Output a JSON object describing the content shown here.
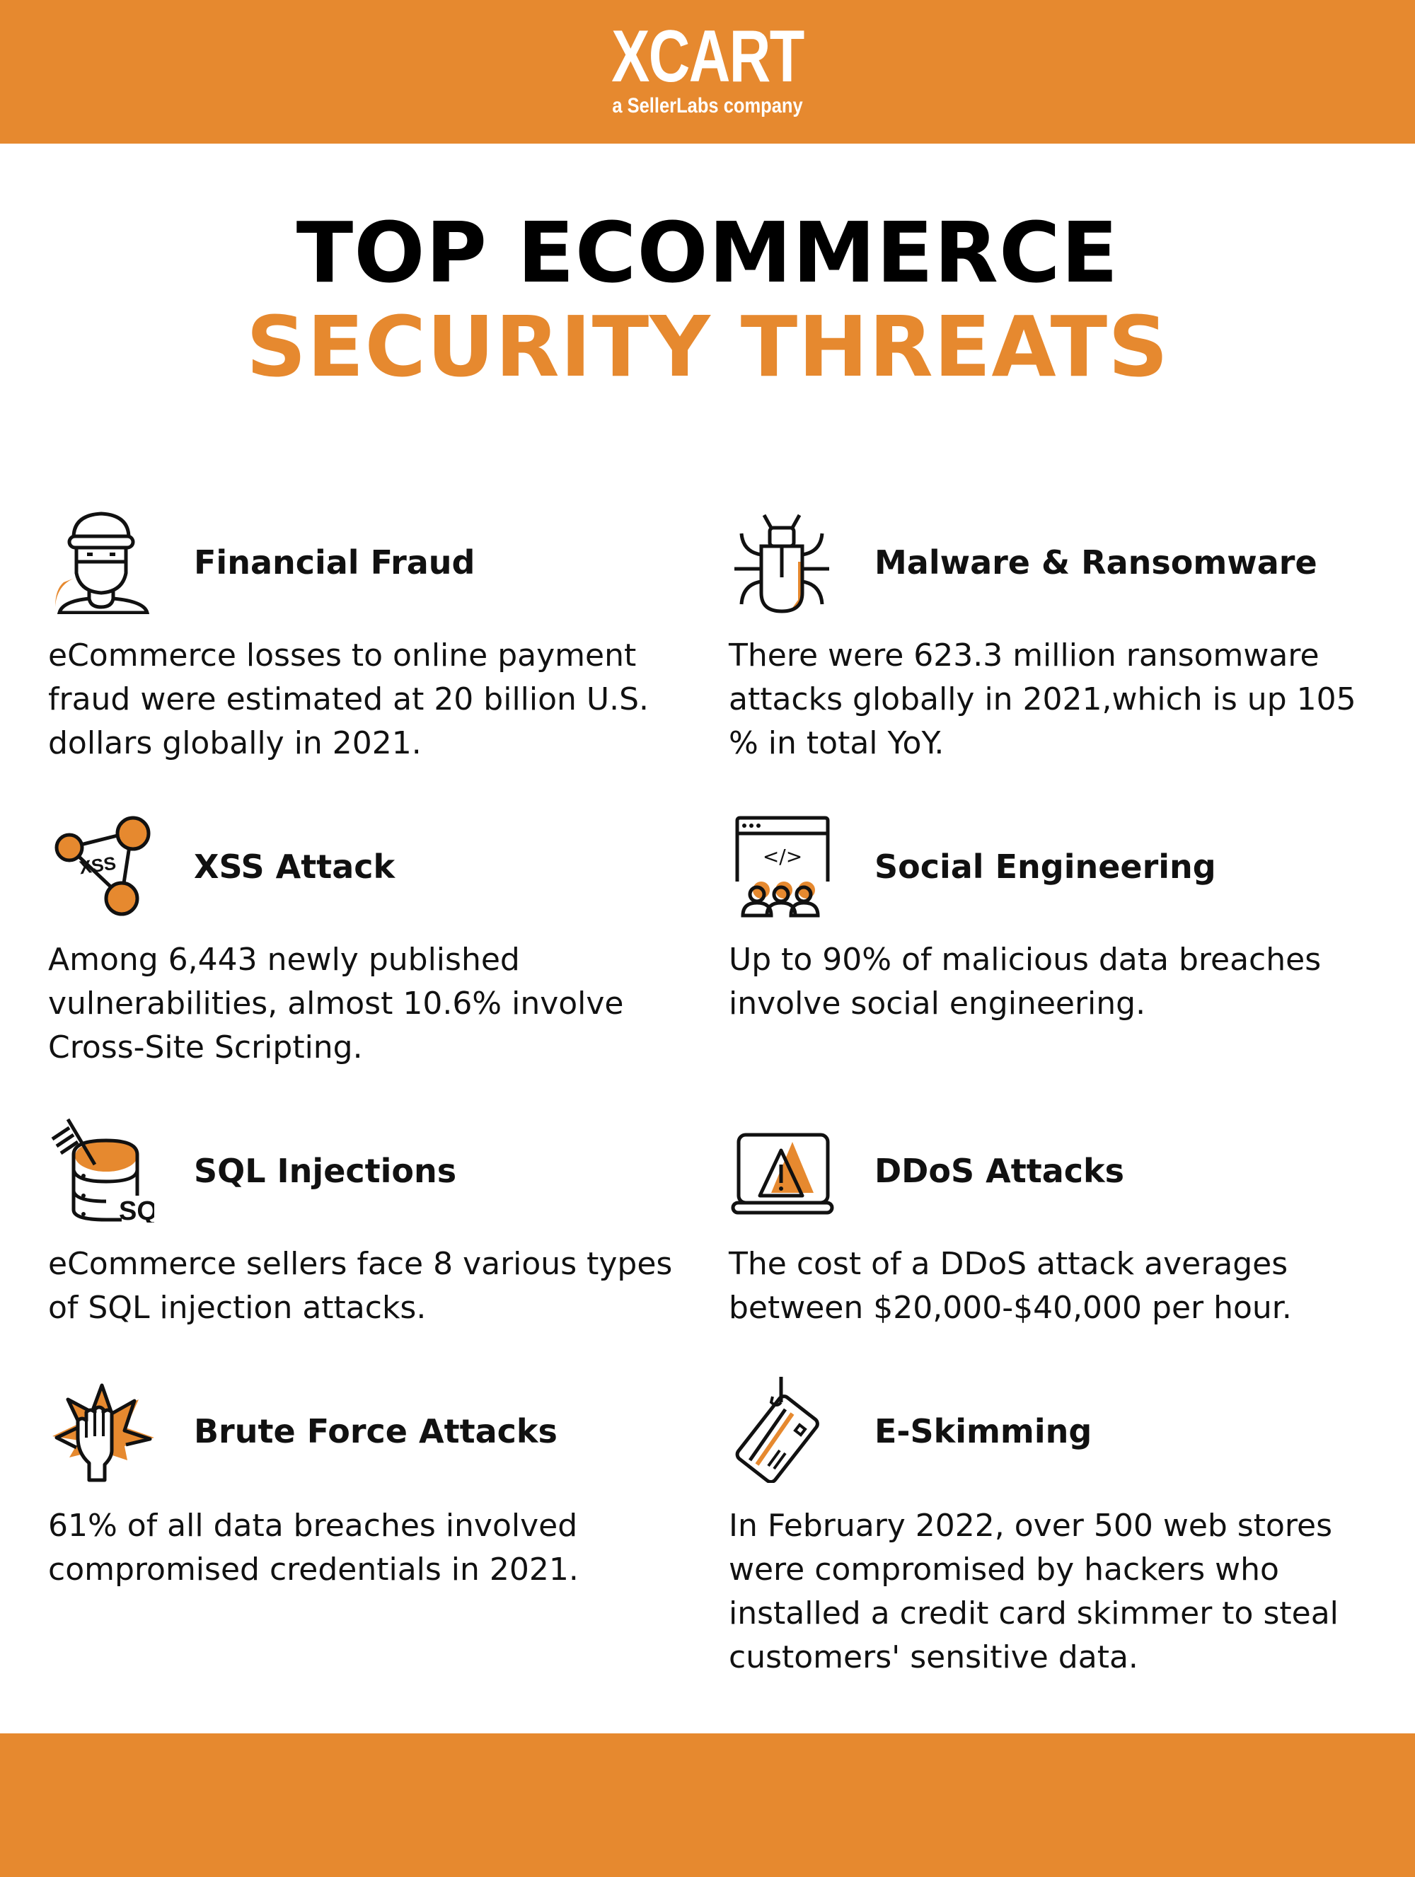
{
  "brand": {
    "logo": "XCART",
    "tagline": "a SellerLabs company",
    "accent_color": "#E6892F",
    "text_color": "#111111"
  },
  "title": {
    "line1": "TOP ECOMMERCE",
    "line2": "SECURITY THREATS"
  },
  "threats": [
    {
      "icon": "masked-thief-icon",
      "heading": "Financial Fraud",
      "text": "eCommerce losses to online payment fraud were estimated at 20 billion U.S. dollars globally in 2021."
    },
    {
      "icon": "bug-icon",
      "heading": "Malware & Ransomware",
      "text": "There were 623.3 million ransomware attacks globally in 2021,which is up 105 % in total YoY."
    },
    {
      "icon": "xss-network-icon",
      "heading": "XSS Attack",
      "text": "Among 6,443 newly published vulnerabilities, almost 10.6% involve Cross-Site Scripting."
    },
    {
      "icon": "browser-code-people-icon",
      "heading": "Social Engineering",
      "text": "Up to 90% of malicious data breaches involve social engineering."
    },
    {
      "icon": "sql-database-syringe-icon",
      "heading": "SQL Injections",
      "text": "eCommerce sellers face 8 various types of SQL injection attacks."
    },
    {
      "icon": "laptop-warning-icon",
      "heading": "DDoS Attacks",
      "text": "The cost of a DDoS attack averages between $20,000-$40,000 per hour."
    },
    {
      "icon": "hand-burst-icon",
      "heading": "Brute Force Attacks",
      "text": "61% of all data breaches involved compromised credentials in 2021."
    },
    {
      "icon": "hooked-credit-card-icon",
      "heading": "E-Skimming",
      "text": "In February 2022, over 500 web stores were compromised by hackers who installed a credit card skimmer to steal customers' sensitive data."
    }
  ]
}
